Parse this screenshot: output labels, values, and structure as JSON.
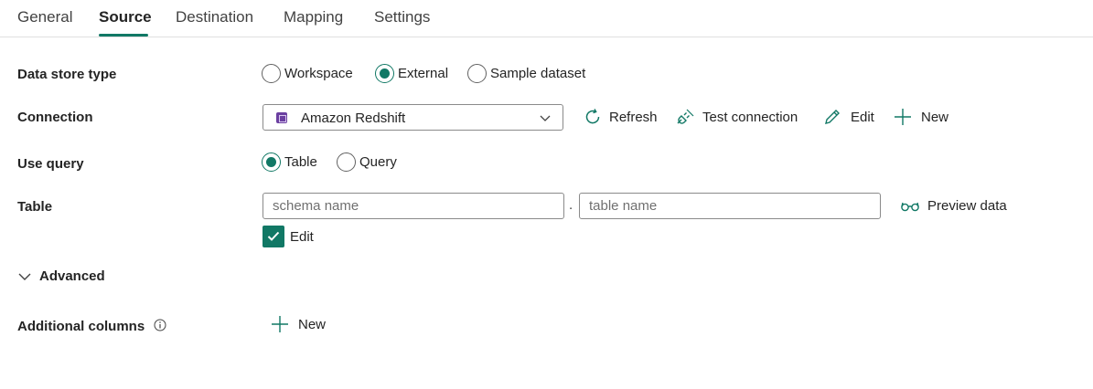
{
  "tabs": [
    {
      "label": "General"
    },
    {
      "label": "Source",
      "active": true
    },
    {
      "label": "Destination"
    },
    {
      "label": "Mapping"
    },
    {
      "label": "Settings"
    }
  ],
  "form": {
    "data_store_type": {
      "label": "Data store type",
      "options": [
        "Workspace",
        "External",
        "Sample dataset"
      ],
      "selected": "External"
    },
    "connection": {
      "label": "Connection",
      "value": "Amazon Redshift",
      "actions": {
        "refresh": "Refresh",
        "test": "Test connection",
        "edit": "Edit",
        "new": "New"
      }
    },
    "use_query": {
      "label": "Use query",
      "options": [
        "Table",
        "Query"
      ],
      "selected": "Table"
    },
    "table": {
      "label": "Table",
      "schema_placeholder": "schema name",
      "separator": ".",
      "table_placeholder": "table name",
      "preview_label": "Preview data",
      "edit_label": "Edit",
      "edit_checked": true
    },
    "advanced": {
      "label": "Advanced",
      "expanded": true
    },
    "additional_columns": {
      "label": "Additional columns",
      "new_label": "New"
    }
  },
  "colors": {
    "accent": "#117865",
    "text": "#242424",
    "border": "#8a8a8a"
  }
}
